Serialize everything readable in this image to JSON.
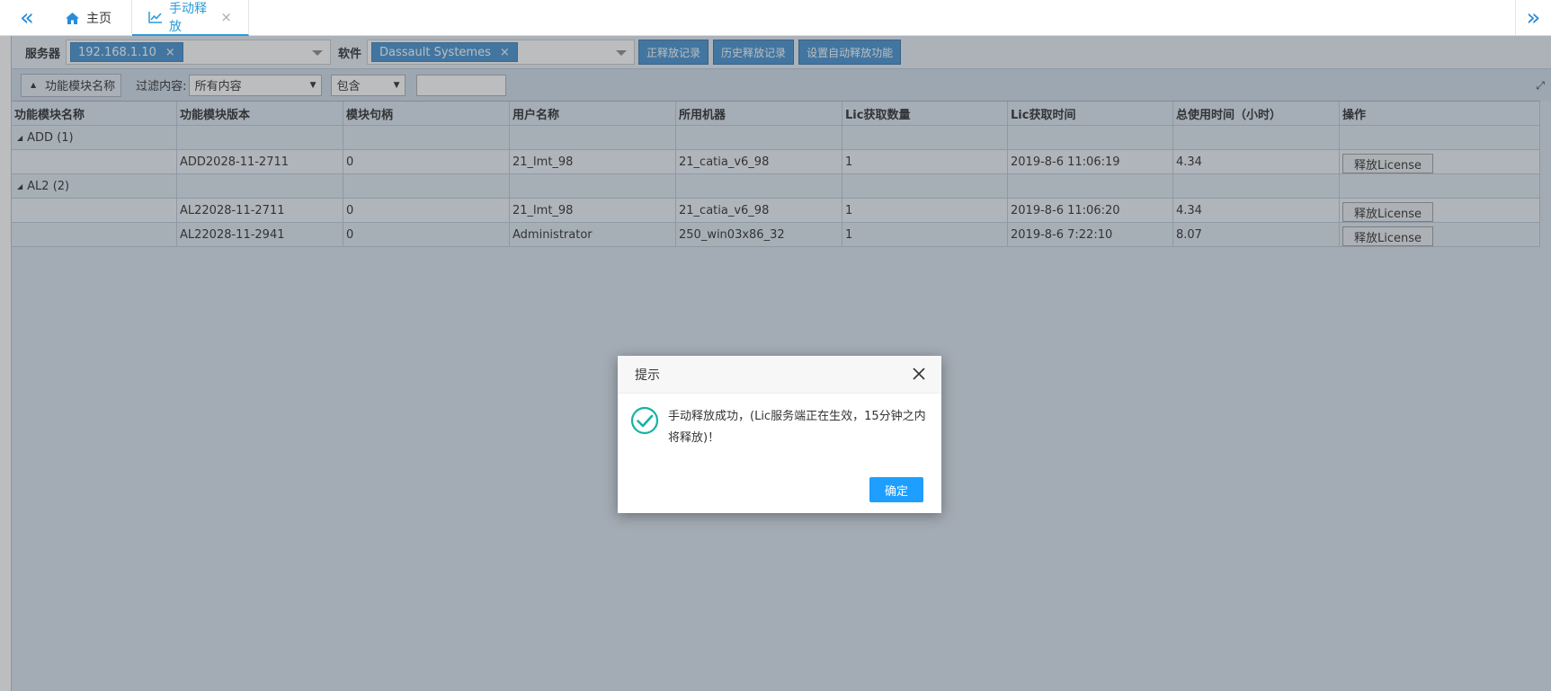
{
  "tabs": {
    "home_label": "主页",
    "active_label": "手动释放",
    "close_glyph": "×"
  },
  "filters": {
    "server_label": "服务器",
    "server_value": "192.168.1.10",
    "software_label": "软件",
    "software_value": "Dassault Systemes",
    "chip_remove": "×",
    "buttons": [
      "正释放记录",
      "历史释放记录",
      "设置自动释放功能"
    ]
  },
  "toolbar": {
    "group_button": "功能模块名称",
    "filter_label": "过滤内容:",
    "filter_select": "所有内容",
    "match_select": "包含",
    "search_value": ""
  },
  "table": {
    "columns": [
      "功能模块名称",
      "功能模块版本",
      "模块句柄",
      "用户名称",
      "所用机器",
      "Lic获取数量",
      "Lic获取时间",
      "总使用时间（小时）",
      "操作"
    ],
    "groups": [
      {
        "label": "ADD (1)",
        "rows": [
          [
            "",
            "ADD2028-11-2711",
            "0",
            "21_lmt_98",
            "21_catia_v6_98",
            "1",
            "2019-8-6 11:06:19",
            "4.34",
            "释放License"
          ]
        ]
      },
      {
        "label": "AL2 (2)",
        "rows": [
          [
            "",
            "AL22028-11-2711",
            "0",
            "21_lmt_98",
            "21_catia_v6_98",
            "1",
            "2019-8-6 11:06:20",
            "4.34",
            "释放License"
          ],
          [
            "",
            "AL22028-11-2941",
            "0",
            "Administrator",
            "250_win03x86_32",
            "1",
            "2019-8-6 7:22:10",
            "8.07",
            "释放License"
          ]
        ]
      }
    ]
  },
  "dialog": {
    "title": "提示",
    "message": "手动释放成功，(Lic服务端正在生效，15分钟之内将释放)！",
    "confirm_label": "确定"
  },
  "colors": {
    "accent": "#1e9fff",
    "success": "#16b3a3",
    "chip": "#3c8dcf"
  }
}
